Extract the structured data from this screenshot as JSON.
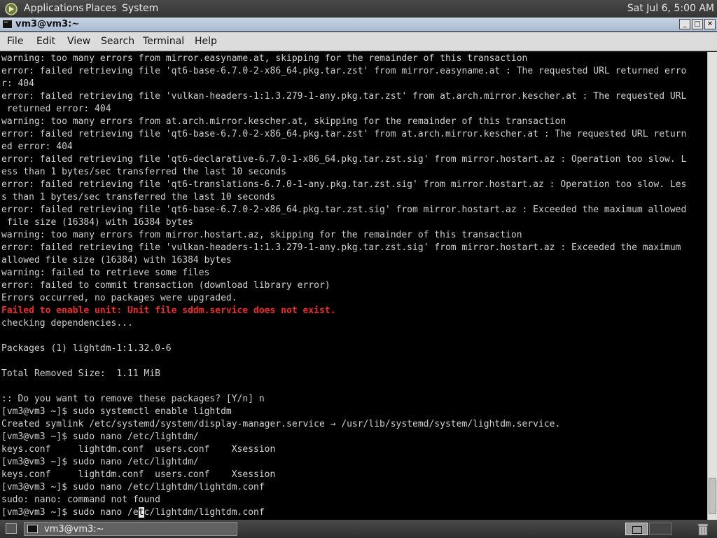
{
  "top_panel": {
    "menus": [
      "Applications",
      "Places",
      "System"
    ],
    "clock": "Sat Jul  6,  5:00 AM"
  },
  "window": {
    "title": "vm3@vm3:~",
    "buttons": {
      "minimize": "_",
      "maximize": "□",
      "close": "✕"
    }
  },
  "menubar": [
    "File",
    "Edit",
    "View",
    "Search",
    "Terminal",
    "Help"
  ],
  "terminal": {
    "lines": [
      "warning: too many errors from mirror.easyname.at, skipping for the remainder of this transaction",
      "error: failed retrieving file 'qt6-base-6.7.0-2-x86_64.pkg.tar.zst' from mirror.easyname.at : The requested URL returned erro",
      "r: 404",
      "error: failed retrieving file 'vulkan-headers-1:1.3.279-1-any.pkg.tar.zst' from at.arch.mirror.kescher.at : The requested URL",
      " returned error: 404",
      "warning: too many errors from at.arch.mirror.kescher.at, skipping for the remainder of this transaction",
      "error: failed retrieving file 'qt6-base-6.7.0-2-x86_64.pkg.tar.zst' from at.arch.mirror.kescher.at : The requested URL return",
      "ed error: 404",
      "error: failed retrieving file 'qt6-declarative-6.7.0-1-x86_64.pkg.tar.zst.sig' from mirror.hostart.az : Operation too slow. L",
      "ess than 1 bytes/sec transferred the last 10 seconds",
      "error: failed retrieving file 'qt6-translations-6.7.0-1-any.pkg.tar.zst.sig' from mirror.hostart.az : Operation too slow. Les",
      "s than 1 bytes/sec transferred the last 10 seconds",
      "error: failed retrieving file 'qt6-base-6.7.0-2-x86_64.pkg.tar.zst.sig' from mirror.hostart.az : Exceeded the maximum allowed",
      " file size (16384) with 16384 bytes",
      "warning: too many errors from mirror.hostart.az, skipping for the remainder of this transaction",
      "error: failed retrieving file 'vulkan-headers-1:1.3.279-1-any.pkg.tar.zst.sig' from mirror.hostart.az : Exceeded the maximum",
      "allowed file size (16384) with 16384 bytes",
      "warning: failed to retrieve some files",
      "error: failed to commit transaction (download library error)",
      "Errors occurred, no packages were upgraded.",
      "Failed to enable unit: Unit file sddm.service does not exist.",
      "checking dependencies...",
      "",
      "Packages (1) lightdm-1:1.32.0-6",
      "",
      "Total Removed Size:  1.11 MiB",
      "",
      ":: Do you want to remove these packages? [Y/n] n",
      "[vm3@vm3 ~]$ sudo systemctl enable lightdm",
      "Created symlink /etc/systemd/system/display-manager.service → /usr/lib/systemd/system/lightdm.service.",
      "[vm3@vm3 ~]$ sudo nano /etc/lightdm/",
      "keys.conf     lightdm.conf  users.conf    Xsession",
      "[vm3@vm3 ~]$ sudo nano /etc/lightdm/",
      "keys.conf     lightdm.conf  users.conf    Xsession",
      "[vm3@vm3 ~]$ sudo nano /etc/lightdm/lightdm.conf",
      "sudo: nano: command not found"
    ],
    "highlight_line_index": 20,
    "prompt_line": {
      "before_cursor": "[vm3@vm3 ~]$ sudo nano /e",
      "cursor_char": "t",
      "after_cursor": "c/lightdm/lightdm.conf"
    }
  },
  "taskbar": {
    "task_label": "vm3@vm3:~"
  },
  "colors": {
    "terminal_bg": "#000000",
    "terminal_fg": "#d0d0d0",
    "error_red": "#ef2929"
  }
}
